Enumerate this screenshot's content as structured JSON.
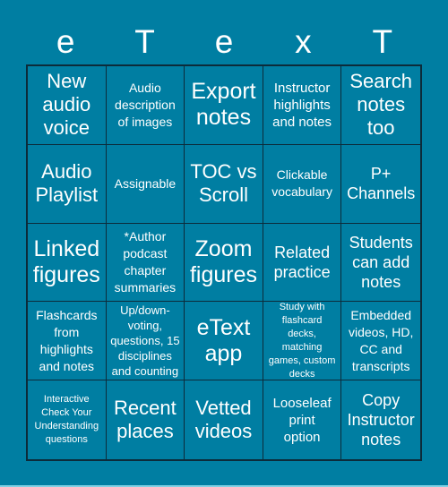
{
  "title_letters": [
    "e",
    "T",
    "e",
    "x",
    "T"
  ],
  "colors": {
    "background": "#007ea2",
    "grid_line": "#0c2b3a",
    "text": "#ffffff",
    "bottom_strip": "#7fd0e4"
  },
  "cells": [
    [
      "New\naudio\nvoice",
      "Audio\ndescription\nof images",
      "Export\nnotes",
      "Instructor\nhighlights\nand notes",
      "Search\nnotes\ntoo"
    ],
    [
      "Audio\nPlaylist",
      "Assignable",
      "TOC vs\nScroll",
      "Clickable\nvocabulary",
      "P+\nChannels"
    ],
    [
      "Linked\nfigures",
      "*Author\npodcast\nchapter\nsummaries",
      "Zoom\nfigures",
      "Related\npractice",
      "Students\ncan add\nnotes"
    ],
    [
      "Flashcards\nfrom\nhighlights\nand notes",
      "Up/down-\nvoting,\nquestions, 15\ndisciplines\nand counting",
      "eText\napp",
      "Study with\nflashcard\ndecks,\nmatching\ngames, custom\ndecks",
      "Embedded\nvideos, HD,\nCC and\ntranscripts"
    ],
    [
      "Interactive\nCheck Your\nUnderstanding\nquestions",
      "Recent\nplaces",
      "Vetted\nvideos",
      "Looseleaf\nprint\noption",
      "Copy\nInstructor\nnotes"
    ]
  ]
}
